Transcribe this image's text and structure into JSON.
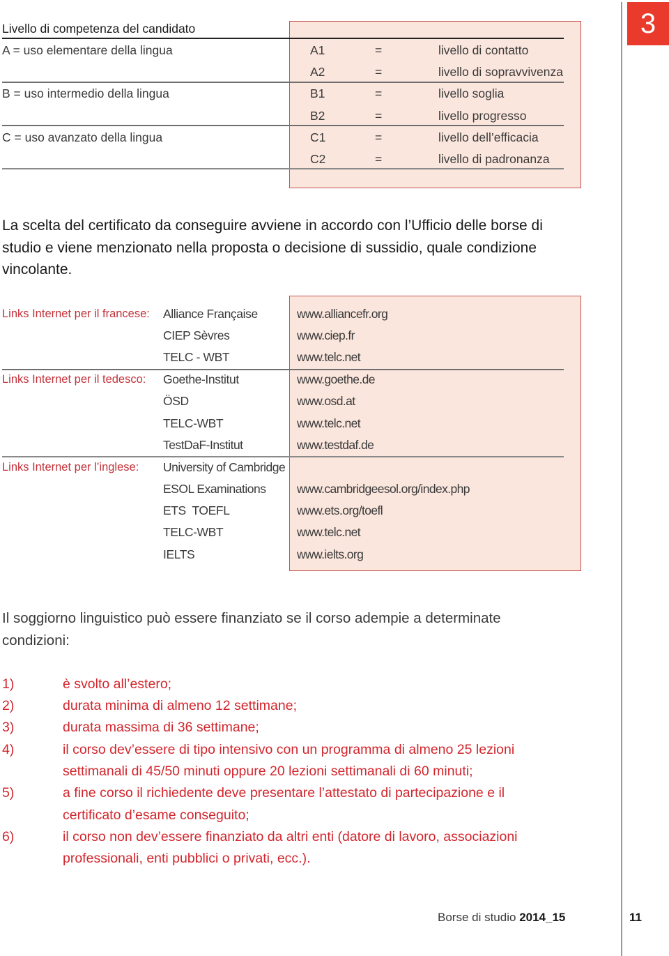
{
  "chapter_number": "3",
  "levels": {
    "heading": "Livello di competenza del candidato",
    "groups": [
      {
        "label": "A = uso elementare della lingua",
        "rows": [
          {
            "code": "A1",
            "eq": "=",
            "desc": "livello di contatto"
          },
          {
            "code": "A2",
            "eq": "=",
            "desc": "livello di sopravvivenza"
          }
        ]
      },
      {
        "label": "B = uso intermedio della lingua",
        "rows": [
          {
            "code": "B1",
            "eq": "=",
            "desc": "livello soglia"
          },
          {
            "code": "B2",
            "eq": "=",
            "desc": "livello progresso"
          }
        ]
      },
      {
        "label": "C = uso avanzato della lingua",
        "rows": [
          {
            "code": "C1",
            "eq": "=",
            "desc": "livello dell’efficacia"
          },
          {
            "code": "C2",
            "eq": "=",
            "desc": "livello di padronanza"
          }
        ]
      }
    ]
  },
  "certificate_paragraph": "La scelta del certificato da conseguire avviene in accordo con l’Ufficio delle borse di studio e viene menzionato nella proposta o decisione di sussidio, quale condizione vincolante.",
  "certificate_paragraph_lines": [
    "La scelta del certificato da conseguire avviene in accordo con l’Ufficio delle borse di",
    "studio e viene menzionato nella proposta o decisione di sussidio, quale condizione",
    "vincolante."
  ],
  "links": [
    {
      "label": "Links Internet per il francese:",
      "items": [
        {
          "name": "Alliance Française",
          "url": "www.alliancefr.org"
        },
        {
          "name": "CIEP Sèvres",
          "url": "www.ciep.fr"
        },
        {
          "name": "TELC - WBT",
          "url": "www.telc.net"
        }
      ]
    },
    {
      "label": "Links Internet per il tedesco:",
      "items": [
        {
          "name": "Goethe-Institut",
          "url": "www.goethe.de"
        },
        {
          "name": "ÖSD",
          "url": "www.osd.at"
        },
        {
          "name": "TELC-WBT",
          "url": "www.telc.net"
        },
        {
          "name": "TestDaF-Institut",
          "url": "www.testdaf.de"
        }
      ]
    },
    {
      "label": "Links Internet per l’inglese:",
      "items": [
        {
          "name": "University of Cambridge",
          "url": ""
        },
        {
          "name": "ESOL Examinations",
          "url": "www.cambridgeesol.org/index.php"
        },
        {
          "name": "ETS  TOEFL",
          "url": "www.ets.org/toefl"
        },
        {
          "name": "TELC-WBT",
          "url": "www.telc.net"
        },
        {
          "name": "IELTS",
          "url": "www.ielts.org"
        }
      ]
    }
  ],
  "conditions_intro_lines": [
    "Il soggiorno linguistico può essere finanziato se il corso adempie a determinate",
    "condizioni:"
  ],
  "conditions": [
    {
      "num": "1)",
      "lines": [
        "è svolto all’estero;"
      ]
    },
    {
      "num": "2)",
      "lines": [
        "durata minima di almeno 12 settimane;"
      ]
    },
    {
      "num": "3)",
      "lines": [
        "durata massima di 36 settimane;"
      ]
    },
    {
      "num": "4)",
      "lines": [
        "il corso dev’essere di tipo intensivo con un programma di almeno 25 lezioni",
        "settimanali di 45/50 minuti oppure 20 lezioni settimanali di 60 minuti;"
      ]
    },
    {
      "num": "5)",
      "lines": [
        "a fine corso il richiedente deve presentare l’attestato di partecipazione e il",
        "certificato d’esame conseguito;"
      ]
    },
    {
      "num": "6)",
      "lines": [
        "il corso non dev’essere finanziato da altri enti (datore di lavoro, associazioni",
        "professionali, enti pubblici o privati, ecc.)."
      ]
    }
  ],
  "footer": {
    "title": "Borse di studio ",
    "year": "2014_15",
    "page_number": "11"
  },
  "colors": {
    "accent_red": "#d2262d",
    "badge_red": "#ea3a2c",
    "box_fill": "#fbe6dd",
    "box_border": "#c9504f"
  }
}
